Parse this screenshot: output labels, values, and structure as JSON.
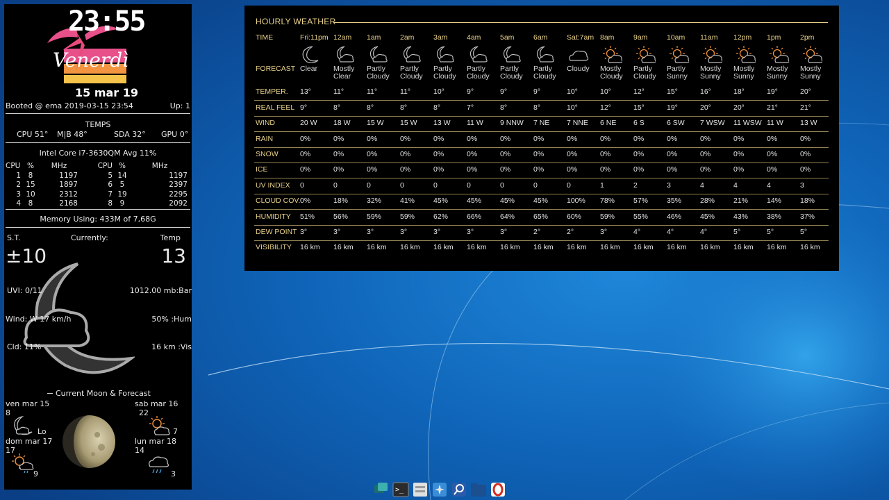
{
  "clock": {
    "time": "23:55",
    "day": "Venerdì",
    "date": "15 mar 19"
  },
  "system": {
    "booted": "Booted @ ema 2019-03-15 23:54",
    "uptime": "Up: 1",
    "temps_title": "TEMPS",
    "temps": [
      {
        "label": "CPU 51°"
      },
      {
        "label": "M|B 48°"
      },
      {
        "label": "SDA 32°"
      },
      {
        "label": "GPU 0°"
      }
    ],
    "cpu_model": "Intel Core i7-3630QM Avg  11%",
    "cpu_headers": [
      "CPU",
      "%",
      "MHz",
      "CPU",
      "%",
      "MHz"
    ],
    "cpu_rows": [
      [
        "1",
        "8",
        "1197",
        "5",
        "14",
        "1197"
      ],
      [
        "2",
        "15",
        "1897",
        "6",
        "5",
        "2397"
      ],
      [
        "3",
        "10",
        "2312",
        "7",
        "19",
        "2295"
      ],
      [
        "4",
        "8",
        "2168",
        "8",
        "9",
        "2092"
      ]
    ],
    "memory": "Memory  Using: 433M of 7,68G"
  },
  "current": {
    "st_label": "S.T.",
    "currently_label": "Currently:",
    "temp_label": "Temp",
    "st_value": "±10",
    "temp_value": "13",
    "uvi": "UVI: 0/11",
    "pressure": "1012.00 mb:Bar",
    "wind": "Wind: W 17 km/h",
    "humidity": "50% :Hum",
    "cloud": "Cld: 11%",
    "visibility": "16 km :Vis"
  },
  "moon": {
    "title": "Current Moon & Forecast",
    "days": [
      {
        "date": "ven mar 15",
        "high": "8",
        "low": "Lo",
        "icon": "moon-cloud-icon"
      },
      {
        "date": "sab mar 16",
        "high": "22",
        "low": "7",
        "icon": "sun-cloud-icon"
      },
      {
        "date": "dom mar 17",
        "high": "17",
        "low": "9",
        "icon": "sun-cloud-rain-icon"
      },
      {
        "date": "lun mar 18",
        "high": "14",
        "low": "3",
        "icon": "cloud-rain-icon"
      }
    ]
  },
  "weather": {
    "title": "HOURLY WEATHER",
    "row_labels": {
      "time": "TIME",
      "forecast": "FORECAST",
      "temper": "TEMPER.",
      "realfeel": "REAL FEEL",
      "wind": "WIND",
      "rain": "RAIN",
      "snow": "SNOW",
      "ice": "ICE",
      "uv": "UV INDEX",
      "cloud": "CLOUD COV.",
      "humidity": "HUMIDITY",
      "dew": "DEW POINT",
      "visibility": "VISIBILITY"
    },
    "hours": [
      {
        "time": "Fri:11pm",
        "icon": "moon",
        "fc": "Clear",
        "temp": "13°",
        "feel": "9°",
        "wind": "20 W",
        "rain": "0%",
        "snow": "0%",
        "ice": "0%",
        "uv": "0",
        "cloud": "0%",
        "hum": "51%",
        "dew": "3°",
        "vis": "16 km"
      },
      {
        "time": "12am",
        "icon": "moon-cloud",
        "fc": "Mostly Clear",
        "temp": "11°",
        "feel": "8°",
        "wind": "18 W",
        "rain": "0%",
        "snow": "0%",
        "ice": "0%",
        "uv": "0",
        "cloud": "18%",
        "hum": "56%",
        "dew": "3°",
        "vis": "16 km"
      },
      {
        "time": "1am",
        "icon": "moon-cloud",
        "fc": "Partly Cloudy",
        "temp": "11°",
        "feel": "8°",
        "wind": "15 W",
        "rain": "0%",
        "snow": "0%",
        "ice": "0%",
        "uv": "0",
        "cloud": "32%",
        "hum": "59%",
        "dew": "3°",
        "vis": "16 km"
      },
      {
        "time": "2am",
        "icon": "moon-cloud",
        "fc": "Partly Cloudy",
        "temp": "11°",
        "feel": "8°",
        "wind": "15 W",
        "rain": "0%",
        "snow": "0%",
        "ice": "0%",
        "uv": "0",
        "cloud": "41%",
        "hum": "59%",
        "dew": "3°",
        "vis": "16 km"
      },
      {
        "time": "3am",
        "icon": "moon-cloud",
        "fc": "Partly Cloudy",
        "temp": "10°",
        "feel": "8°",
        "wind": "13 W",
        "rain": "0%",
        "snow": "0%",
        "ice": "0%",
        "uv": "0",
        "cloud": "45%",
        "hum": "62%",
        "dew": "3°",
        "vis": "16 km"
      },
      {
        "time": "4am",
        "icon": "moon-cloud",
        "fc": "Partly Cloudy",
        "temp": "9°",
        "feel": "7°",
        "wind": "11 W",
        "rain": "0%",
        "snow": "0%",
        "ice": "0%",
        "uv": "0",
        "cloud": "45%",
        "hum": "66%",
        "dew": "3°",
        "vis": "16 km"
      },
      {
        "time": "5am",
        "icon": "moon-cloud",
        "fc": "Partly Cloudy",
        "temp": "9°",
        "feel": "8°",
        "wind": "9 NNW",
        "rain": "0%",
        "snow": "0%",
        "ice": "0%",
        "uv": "0",
        "cloud": "45%",
        "hum": "64%",
        "dew": "3°",
        "vis": "16 km"
      },
      {
        "time": "6am",
        "icon": "moon-cloud",
        "fc": "Partly Cloudy",
        "temp": "9°",
        "feel": "8°",
        "wind": "7 NE",
        "rain": "0%",
        "snow": "0%",
        "ice": "0%",
        "uv": "0",
        "cloud": "45%",
        "hum": "65%",
        "dew": "2°",
        "vis": "16 km"
      },
      {
        "time": "Sat:7am",
        "icon": "cloud",
        "fc": "Cloudy",
        "temp": "10°",
        "feel": "10°",
        "wind": "7 NNE",
        "rain": "0%",
        "snow": "0%",
        "ice": "0%",
        "uv": "0",
        "cloud": "100%",
        "hum": "60%",
        "dew": "2°",
        "vis": "16 km"
      },
      {
        "time": "8am",
        "icon": "sun-cloud",
        "fc": "Mostly Cloudy",
        "temp": "10°",
        "feel": "12°",
        "wind": "6 NE",
        "rain": "0%",
        "snow": "0%",
        "ice": "0%",
        "uv": "1",
        "cloud": "78%",
        "hum": "59%",
        "dew": "3°",
        "vis": "16 km"
      },
      {
        "time": "9am",
        "icon": "sun-cloud",
        "fc": "Partly Cloudy",
        "temp": "12°",
        "feel": "15°",
        "wind": "6 S",
        "rain": "0%",
        "snow": "0%",
        "ice": "0%",
        "uv": "2",
        "cloud": "57%",
        "hum": "55%",
        "dew": "4°",
        "vis": "16 km"
      },
      {
        "time": "10am",
        "icon": "sun-cloud",
        "fc": "Partly Sunny",
        "temp": "15°",
        "feel": "19°",
        "wind": "6 SW",
        "rain": "0%",
        "snow": "0%",
        "ice": "0%",
        "uv": "3",
        "cloud": "35%",
        "hum": "46%",
        "dew": "4°",
        "vis": "16 km"
      },
      {
        "time": "11am",
        "icon": "sun-cloud",
        "fc": "Mostly Sunny",
        "temp": "16°",
        "feel": "20°",
        "wind": "7 WSW",
        "rain": "0%",
        "snow": "0%",
        "ice": "0%",
        "uv": "4",
        "cloud": "28%",
        "hum": "45%",
        "dew": "4°",
        "vis": "16 km"
      },
      {
        "time": "12pm",
        "icon": "sun-cloud",
        "fc": "Mostly Sunny",
        "temp": "18°",
        "feel": "20°",
        "wind": "11 WSW",
        "rain": "0%",
        "snow": "0%",
        "ice": "0%",
        "uv": "4",
        "cloud": "21%",
        "hum": "43%",
        "dew": "5°",
        "vis": "16 km"
      },
      {
        "time": "1pm",
        "icon": "sun-cloud",
        "fc": "Mostly Sunny",
        "temp": "19°",
        "feel": "21°",
        "wind": "11 W",
        "rain": "0%",
        "snow": "0%",
        "ice": "0%",
        "uv": "4",
        "cloud": "14%",
        "hum": "38%",
        "dew": "5°",
        "vis": "16 km"
      },
      {
        "time": "2pm",
        "icon": "sun-cloud",
        "fc": "Mostly Sunny",
        "temp": "20°",
        "feel": "21°",
        "wind": "13 W",
        "rain": "0%",
        "snow": "0%",
        "ice": "0%",
        "uv": "3",
        "cloud": "18%",
        "hum": "37%",
        "dew": "5°",
        "vis": "16 km"
      }
    ]
  },
  "dock": [
    {
      "name": "dock-app-manager-icon",
      "color": "#2d8a8a"
    },
    {
      "name": "dock-terminal-icon",
      "color": "#333333"
    },
    {
      "name": "dock-files-icon",
      "color": "#d9d9d9"
    },
    {
      "name": "dock-browser-icon",
      "color": "#3a8ed8"
    },
    {
      "name": "dock-search-icon",
      "color": "#2a5aa8"
    },
    {
      "name": "dock-folder-icon",
      "color": "#1b4f8f"
    },
    {
      "name": "dock-opera-icon",
      "color": "#d52b1e"
    }
  ]
}
